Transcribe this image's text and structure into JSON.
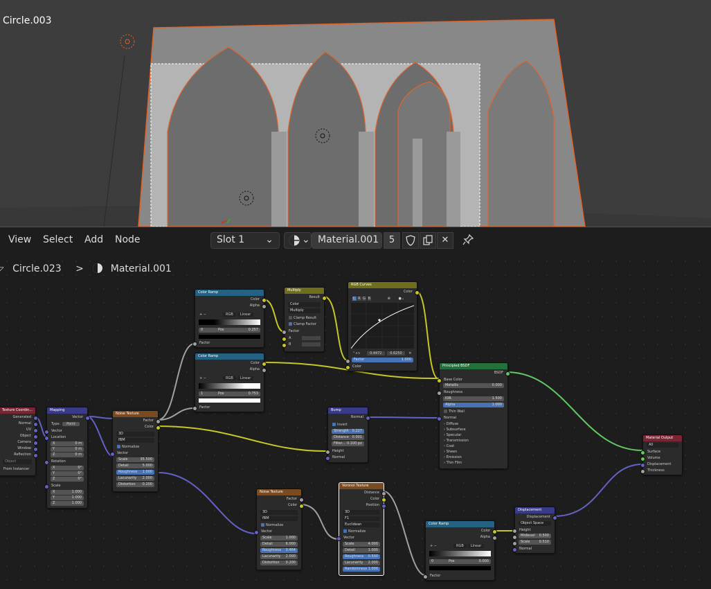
{
  "viewport": {
    "object_name": "Circle.003"
  },
  "header": {
    "menus": [
      "View",
      "Select",
      "Add",
      "Node"
    ],
    "slot": "Slot 1",
    "material_name": "Material.001",
    "user_count": "5",
    "icons": [
      "material-sphere-icon",
      "fake-user-shield-icon",
      "duplicate-icon",
      "unlink-x-icon",
      "pin-icon"
    ]
  },
  "breadcrumb": {
    "object": "Circle.023",
    "separator": ">",
    "material": "Material.001"
  },
  "colors": {
    "shader": "#24703a",
    "texture": "#7a4a20",
    "vector": "#3a3a8a",
    "converter": "#246283",
    "color": "#6e6e1e",
    "output": "#7a2434"
  },
  "nodes": {
    "texcoord": {
      "title": "Texture Coordin...",
      "outputs": [
        "Generated",
        "Normal",
        "UV",
        "Object",
        "Camera",
        "Window",
        "Reflection"
      ],
      "object_placeholder": "Object",
      "from_instancer": "From Instancer"
    },
    "mapping": {
      "title": "Mapping",
      "out": "Vector",
      "type_label": "Type:",
      "type_value": "Point",
      "in_vector": "Vector",
      "location": "Location",
      "loc": [
        {
          "a": "X",
          "v": "0 m"
        },
        {
          "a": "Y",
          "v": "0 m"
        },
        {
          "a": "Z",
          "v": "0 m"
        }
      ],
      "rotation": "Rotation",
      "rot": [
        {
          "a": "X",
          "v": "0°"
        },
        {
          "a": "Y",
          "v": "0°"
        },
        {
          "a": "Z",
          "v": "0°"
        }
      ],
      "scale": "Scale",
      "scl": [
        {
          "a": "X",
          "v": "1.000"
        },
        {
          "a": "Y",
          "v": "1.000"
        },
        {
          "a": "Z",
          "v": "1.000"
        }
      ]
    },
    "noise1": {
      "title": "Noise Texture",
      "out_factor": "Factor",
      "out_color": "Color",
      "dim": "3D",
      "type": "fBM",
      "normalize": "Normalize",
      "in_vector": "Vector",
      "fields": [
        {
          "l": "Scale",
          "v": "35.500"
        },
        {
          "l": "Detail",
          "v": "5.000"
        },
        {
          "l": "Roughness",
          "v": "1.000"
        },
        {
          "l": "Lacunarity",
          "v": "2.000"
        },
        {
          "l": "Distortion",
          "v": "0.200"
        }
      ]
    },
    "ramp1": {
      "title": "Color Ramp",
      "out_color": "Color",
      "out_alpha": "Alpha",
      "plus": "+",
      "minus": "−",
      "mode": "RGB",
      "interp": "Linear",
      "index": "0",
      "pos_label": "Pos",
      "pos": "0.257",
      "in": "Factor"
    },
    "ramp2": {
      "title": "Color Ramp",
      "out_color": "Color",
      "out_alpha": "Alpha",
      "plus": "+",
      "minus": "−",
      "mode": "RGB",
      "interp": "Linear",
      "index": "1",
      "pos_label": "Pos",
      "pos": "0.753",
      "in": "Factor"
    },
    "multiply": {
      "title": "Multiply",
      "out": "Result",
      "blend_type": "Color",
      "mode": "Multiply",
      "clamp_result": "Clamp Result",
      "clamp_factor": "Clamp Factor",
      "in_factor": "Factor",
      "in_a": "A",
      "in_b": "B"
    },
    "curves": {
      "title": "RGB Curves",
      "out": "Color",
      "channels": [
        "C",
        "R",
        "G",
        "B"
      ],
      "x": "0.4472",
      "y": "0.6250",
      "factor_label": "Factor",
      "factor": "1.000",
      "in": "Color"
    },
    "bsdf": {
      "title": "Principled BSDF",
      "out": "BSDF",
      "base_color": "Base Color",
      "metallic_l": "Metallic",
      "metallic": "0.000",
      "roughness": "Roughness",
      "ior_l": "IOR",
      "ior": "1.500",
      "alpha_l": "Alpha",
      "alpha": "1.000",
      "thin_wall": "Thin Wall",
      "normal": "Normal",
      "panels": [
        "Diffuse",
        "Subsurface",
        "Specular",
        "Transmission",
        "Coat",
        "Sheen",
        "Emission",
        "Thin Film"
      ]
    },
    "bump": {
      "title": "Bump",
      "out": "Normal",
      "invert": "Invert",
      "strength_l": "Strength",
      "strength": "0.227",
      "distance_l": "Distance",
      "distance": "0.001",
      "filter_l": "Filter...",
      "filter": "0.100 px",
      "height": "Height",
      "normal": "Normal"
    },
    "output": {
      "title": "Material Output",
      "target": "All",
      "inputs": [
        "Surface",
        "Volume",
        "Displacement",
        "Thickness"
      ]
    },
    "noise2": {
      "title": "Noise Texture",
      "out_factor": "Factor",
      "out_color": "Color",
      "dim": "3D",
      "type": "fBM",
      "normalize": "Normalize",
      "in_vector": "Vector",
      "fields": [
        {
          "l": "Scale",
          "v": "1.000"
        },
        {
          "l": "Detail",
          "v": "6.000"
        },
        {
          "l": "Roughness",
          "v": "0.464"
        },
        {
          "l": "Lacunarity",
          "v": "2.000"
        },
        {
          "l": "Distortion",
          "v": "0.200"
        }
      ]
    },
    "voronoi": {
      "title": "Voronoi Texture",
      "out_distance": "Distance",
      "out_color": "Color",
      "out_position": "Position",
      "dim": "3D",
      "feature": "F1",
      "metric": "Euclidean",
      "normalize": "Normalize",
      "in_vector": "Vector",
      "fields": [
        {
          "l": "Scale",
          "v": "4.000"
        },
        {
          "l": "Detail",
          "v": "1.000"
        },
        {
          "l": "Roughness",
          "v": "0.500"
        },
        {
          "l": "Lacunarity",
          "v": "2.000"
        },
        {
          "l": "Randomness",
          "v": "1.000"
        }
      ]
    },
    "ramp3": {
      "title": "Color Ramp",
      "out_color": "Color",
      "out_alpha": "Alpha",
      "plus": "+",
      "minus": "−",
      "mode": "RGB",
      "interp": "Linear",
      "index": "0",
      "pos_label": "Pos",
      "pos": "0.000",
      "in": "Factor"
    },
    "disp": {
      "title": "Displacement",
      "out": "Displacement",
      "space": "Object Space",
      "height": "Height",
      "midlevel_l": "Midlevel",
      "midlevel": "0.500",
      "scale_l": "Scale",
      "scale": "0.510",
      "normal": "Normal"
    }
  }
}
